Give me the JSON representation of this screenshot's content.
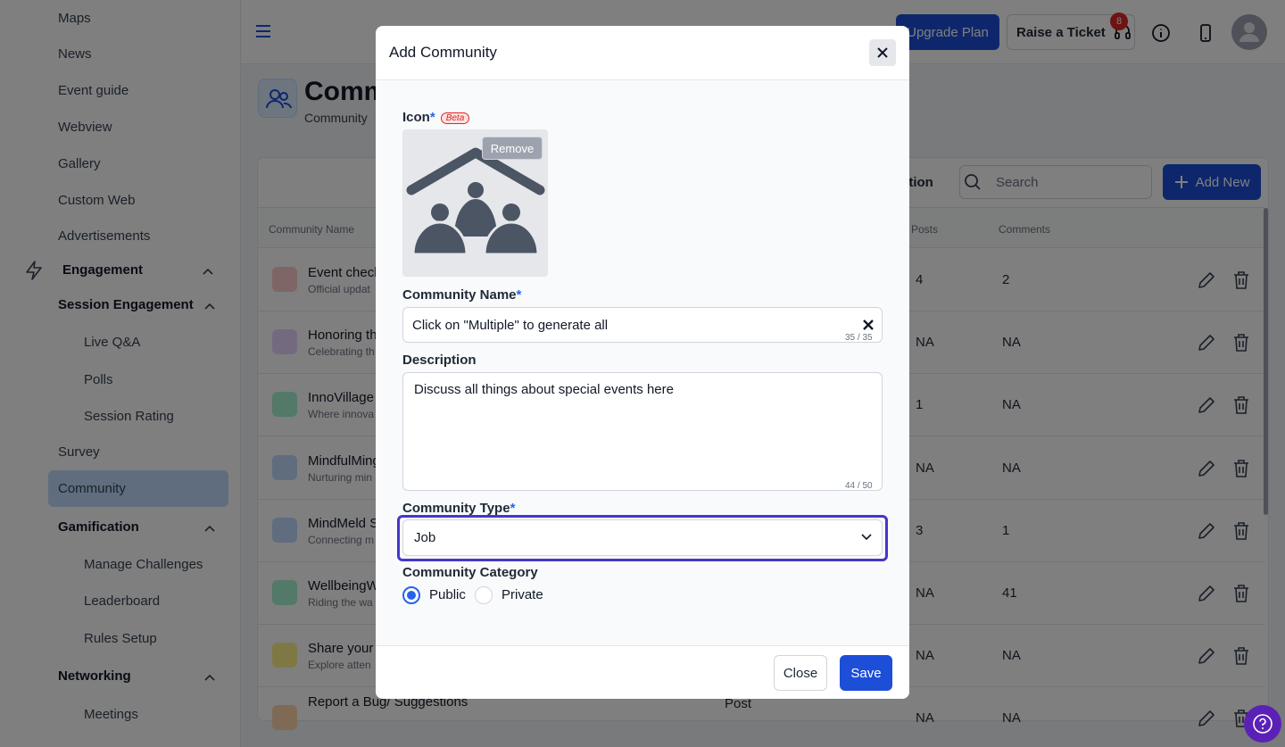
{
  "sidebar": {
    "items": [
      {
        "label": "Maps"
      },
      {
        "label": "News"
      },
      {
        "label": "Event guide"
      },
      {
        "label": "Webview"
      },
      {
        "label": "Gallery"
      },
      {
        "label": "Custom Web"
      },
      {
        "label": "Advertisements"
      }
    ],
    "engagement": "Engagement",
    "session_engagement": "Session Engagement",
    "session_items": [
      "Live Q&A",
      "Polls",
      "Session Rating"
    ],
    "survey": "Survey",
    "community": "Community",
    "gamification": "Gamification",
    "gamification_items": [
      "Manage Challenges",
      "Leaderboard",
      "Rules Setup"
    ],
    "networking": "Networking",
    "networking_items": [
      "Meetings"
    ]
  },
  "header": {
    "upgrade": "Upgrade Plan",
    "ticket": "Raise a Ticket",
    "ticket_count": "8"
  },
  "page": {
    "title": "Comm",
    "subtitle": "Community",
    "filter_label": "ation",
    "search_placeholder": "Search",
    "add_new": "Add New",
    "columns": {
      "name": "Community Name",
      "posts": "Posts",
      "comments": "Comments"
    },
    "rows": [
      {
        "name": "Event check",
        "desc": "Official updat",
        "posts": "4",
        "comments": "2",
        "color": "#fecaca"
      },
      {
        "name": "Honoring th",
        "desc": "Celebrating th",
        "posts": "NA",
        "comments": "NA",
        "color": "#e9d5ff"
      },
      {
        "name": "InnoVillage",
        "desc": "Where innova",
        "posts": "1",
        "comments": "NA",
        "color": "#a7f3d0"
      },
      {
        "name": "MindfulMing",
        "desc": "Nurturing min",
        "posts": "NA",
        "comments": "NA",
        "color": "#bfdbfe"
      },
      {
        "name": "MindMeld S",
        "desc": "Connecting m",
        "posts": "3",
        "comments": "1",
        "color": "#bfdbfe"
      },
      {
        "name": "WellbeingW",
        "desc": "Riding the wa",
        "posts": "NA",
        "comments": "41",
        "color": "#a7f3d0"
      },
      {
        "name": "Share your",
        "desc": "Explore atten",
        "posts": "NA",
        "comments": "NA",
        "color": "#fef08a"
      },
      {
        "name": "Report a Bug/ Suggestions",
        "desc": "",
        "posts": "NA",
        "comments": "NA",
        "type": "Post",
        "color": "#fed7aa"
      }
    ]
  },
  "modal": {
    "title": "Add Community",
    "icon_label": "Icon",
    "beta": "Beta",
    "remove": "Remove",
    "name_label": "Community Name",
    "name_value": "Click on \"Multiple\" to generate all",
    "name_counter": "35 / 35",
    "desc_label": "Description",
    "desc_value": "Discuss all things about special events here",
    "desc_counter": "44 / 50",
    "type_label": "Community Type",
    "type_value": "Job",
    "category_label": "Community Category",
    "category_public": "Public",
    "category_private": "Private",
    "close": "Close",
    "save": "Save"
  }
}
